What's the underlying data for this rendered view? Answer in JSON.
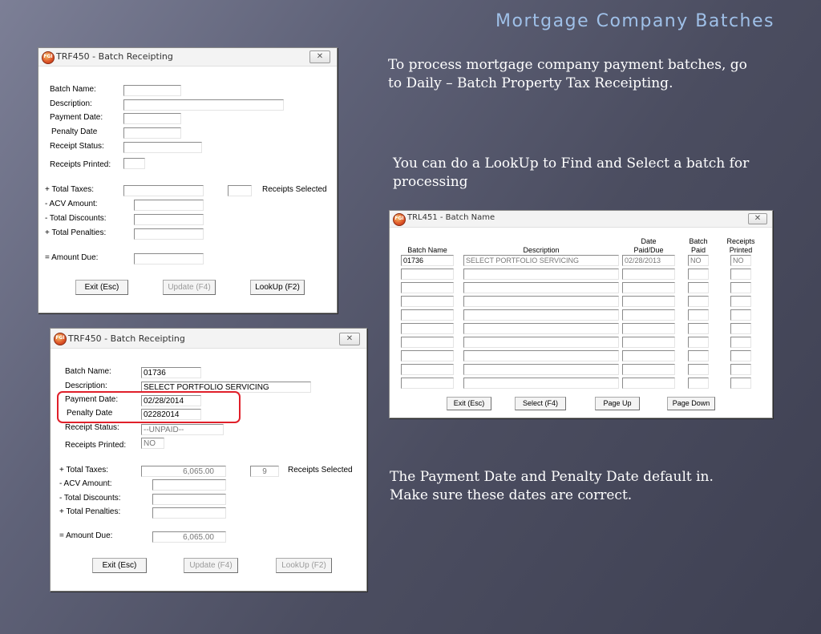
{
  "slide": {
    "title": "Mortgage Company Batches",
    "caption1": "To process mortgage company payment batches, go to Daily – Batch Property Tax Receipting.",
    "caption2": "You can do a LookUp to Find and Select a batch for processing",
    "caption3": "The Payment Date and Penalty Date default in. Make sure these dates are correct."
  },
  "win1": {
    "title": "TRF450 - Batch Receipting",
    "icon": "app-logo-icon",
    "close": "✕",
    "labels": {
      "batch_name": "Batch Name:",
      "description": "Description:",
      "payment_date": "Payment Date:",
      "penalty_date": "Penalty Date",
      "receipt_status": "Receipt Status:",
      "receipts_printed": "Receipts Printed:",
      "total_taxes": "+ Total Taxes:",
      "acv_amount": "- ACV Amount:",
      "total_discounts": "- Total Discounts:",
      "total_penalties": "+ Total Penalties:",
      "amount_due": "= Amount Due:",
      "receipts_selected": "Receipts Selected"
    },
    "values": {
      "batch_name": "",
      "description": "",
      "payment_date": "",
      "penalty_date": "",
      "receipt_status": "",
      "receipts_printed": "",
      "total_taxes": "",
      "receipts_selected": "",
      "acv_amount": "",
      "total_discounts": "",
      "total_penalties": "",
      "amount_due": ""
    },
    "buttons": {
      "exit": "Exit (Esc)",
      "update": "Update (F4)",
      "lookup": "LookUp (F2)"
    }
  },
  "win2": {
    "title": "TRF450 - Batch Receipting",
    "icon": "app-logo-icon",
    "close": "✕",
    "highlight_color": "#e0202a",
    "labels": {
      "batch_name": "Batch Name:",
      "description": "Description:",
      "payment_date": "Payment Date:",
      "penalty_date": "Penalty Date",
      "receipt_status": "Receipt Status:",
      "receipts_printed": "Receipts Printed:",
      "total_taxes": "+ Total Taxes:",
      "acv_amount": "- ACV Amount:",
      "total_discounts": "- Total Discounts:",
      "total_penalties": "+ Total Penalties:",
      "amount_due": "= Amount Due:",
      "receipts_selected": "Receipts Selected"
    },
    "values": {
      "batch_name": "01736",
      "description": "SELECT PORTFOLIO SERVICING",
      "payment_date": "02/28/2014",
      "penalty_date": "02282014",
      "receipt_status": "--UNPAID--",
      "receipts_printed": "NO",
      "total_taxes": "6,065.00",
      "receipts_selected": "9",
      "acv_amount": "",
      "total_discounts": "",
      "total_penalties": "",
      "amount_due": "6,065.00"
    },
    "buttons": {
      "exit": "Exit (Esc)",
      "update": "Update (F4)",
      "lookup": "LookUp (F2)"
    }
  },
  "win3": {
    "title": "TRL451 - Batch Name",
    "icon": "app-logo-icon",
    "close": "✕",
    "headers": {
      "batch_name": "Batch Name",
      "description": "Description",
      "date_1": "Date",
      "date_2": "Paid/Due",
      "paid_1": "Batch",
      "paid_2": "Paid",
      "printed_1": "Receipts",
      "printed_2": "Printed"
    },
    "rows": [
      {
        "batch_name": "01736",
        "description": "SELECT PORTFOLIO SERVICING",
        "date": "02/28/2013",
        "paid": "NO",
        "printed": "NO"
      },
      {
        "batch_name": "",
        "description": "",
        "date": "",
        "paid": "",
        "printed": ""
      },
      {
        "batch_name": "",
        "description": "",
        "date": "",
        "paid": "",
        "printed": ""
      },
      {
        "batch_name": "",
        "description": "",
        "date": "",
        "paid": "",
        "printed": ""
      },
      {
        "batch_name": "",
        "description": "",
        "date": "",
        "paid": "",
        "printed": ""
      },
      {
        "batch_name": "",
        "description": "",
        "date": "",
        "paid": "",
        "printed": ""
      },
      {
        "batch_name": "",
        "description": "",
        "date": "",
        "paid": "",
        "printed": ""
      },
      {
        "batch_name": "",
        "description": "",
        "date": "",
        "paid": "",
        "printed": ""
      },
      {
        "batch_name": "",
        "description": "",
        "date": "",
        "paid": "",
        "printed": ""
      },
      {
        "batch_name": "",
        "description": "",
        "date": "",
        "paid": "",
        "printed": ""
      }
    ],
    "buttons": {
      "exit": "Exit (Esc)",
      "select": "Select (F4)",
      "page_up": "Page Up",
      "page_down": "Page Down"
    }
  }
}
